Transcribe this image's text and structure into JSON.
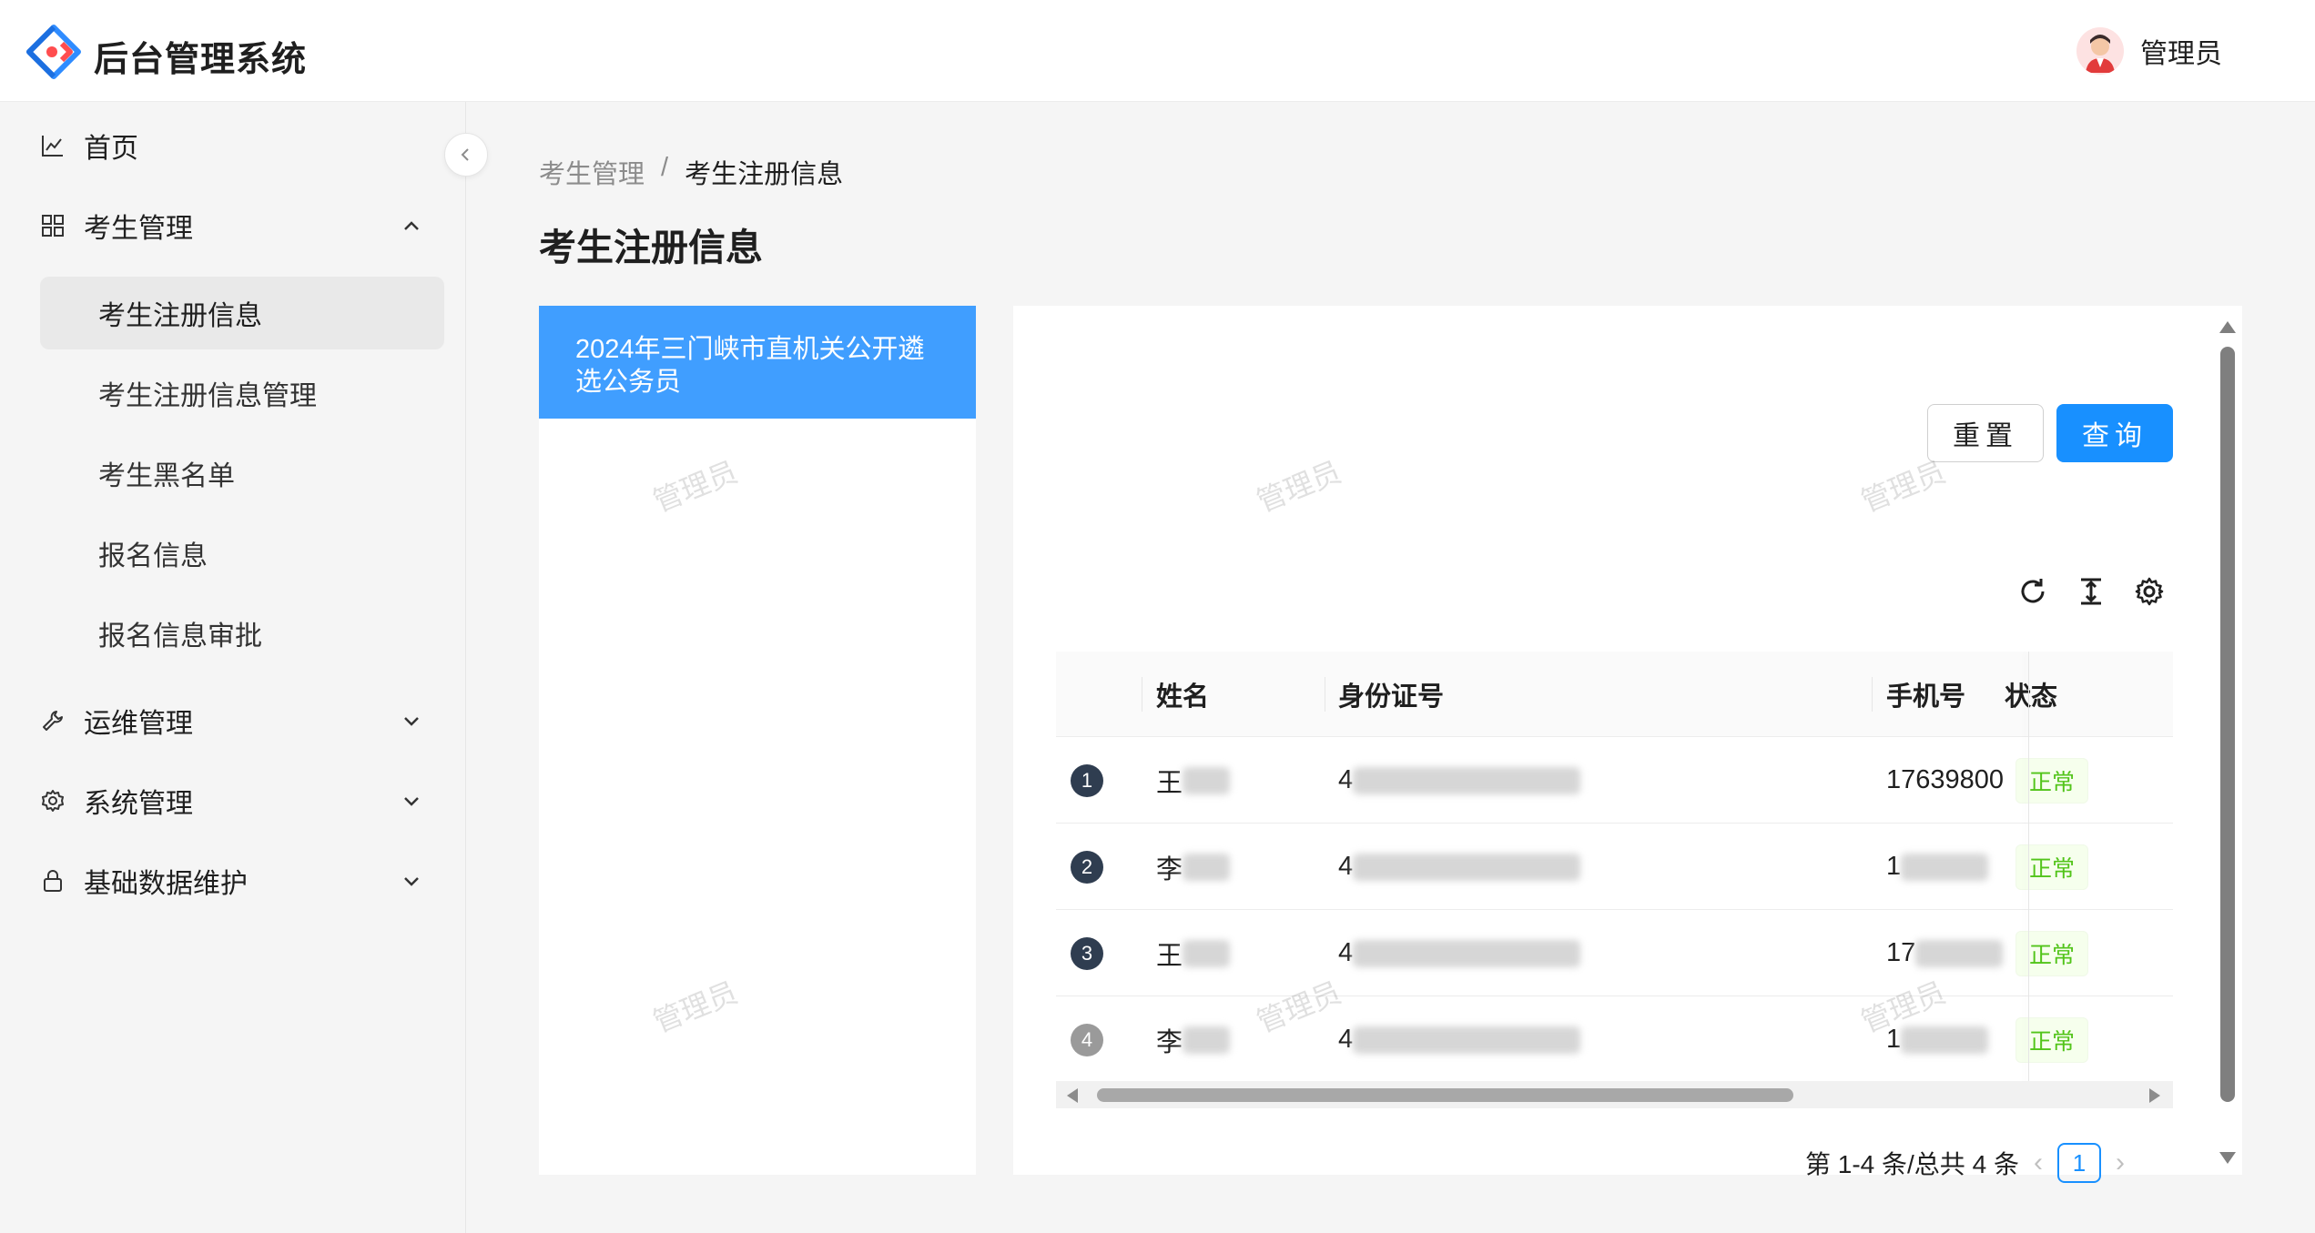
{
  "header": {
    "app_title": "后台管理系统",
    "user_name": "管理员"
  },
  "sidebar": {
    "home": "首页",
    "examinee_mgmt": "考生管理",
    "sub_items": [
      "考生注册信息",
      "考生注册信息管理",
      "考生黑名单",
      "报名信息",
      "报名信息审批"
    ],
    "ops_mgmt": "运维管理",
    "system_mgmt": "系统管理",
    "base_data": "基础数据维护"
  },
  "breadcrumb": {
    "parent": "考生管理",
    "separator": "/",
    "current": "考生注册信息"
  },
  "page_title": "考生注册信息",
  "exam_list": [
    "2024年三门峡市直机关公开遴选公务员"
  ],
  "actions": {
    "reset": "重置",
    "query": "查询"
  },
  "table": {
    "columns": [
      "姓名",
      "身份证号",
      "手机号",
      "状态"
    ],
    "rows": [
      {
        "index": "1",
        "name_visible": "王",
        "id_visible": "4",
        "phone_visible": "17639800",
        "status": "正常"
      },
      {
        "index": "2",
        "name_visible": "李",
        "id_visible": "4",
        "phone_visible": "1",
        "status": "正常"
      },
      {
        "index": "3",
        "name_visible": "王",
        "id_visible": "4",
        "phone_visible": "17",
        "status": "正常"
      },
      {
        "index": "4",
        "name_visible": "李",
        "id_visible": "4",
        "phone_visible": "1",
        "status": "正常"
      }
    ]
  },
  "pagination": {
    "summary": "第 1-4 条/总共 4 条",
    "current_page": "1"
  },
  "watermark": "管理员",
  "colors": {
    "primary": "#1890ff",
    "selected_exam": "#409eff",
    "status_ok": "#52c41a",
    "index_badge": "#2f3d50"
  },
  "icons": [
    "logo-icon",
    "avatar-icon",
    "chart-icon",
    "grid-icon",
    "chevron-up-icon",
    "wrench-icon",
    "gear-icon",
    "lock-icon",
    "chevron-down-icon",
    "chevron-left-icon",
    "refresh-icon",
    "column-height-icon",
    "settings-icon"
  ]
}
